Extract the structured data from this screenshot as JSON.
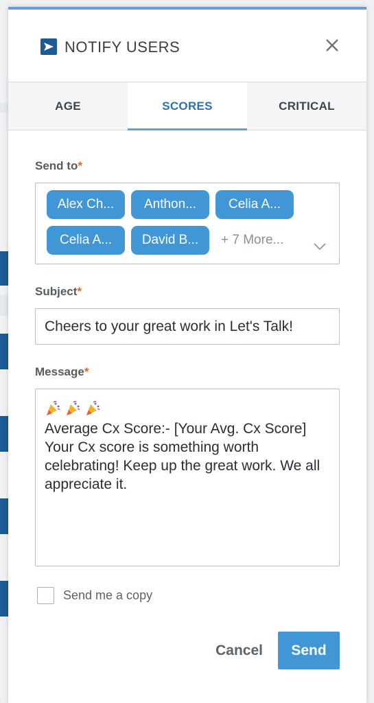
{
  "header": {
    "title": "NOTIFY USERS"
  },
  "tabs": [
    {
      "label": "AGE",
      "active": false
    },
    {
      "label": "SCORES",
      "active": true
    },
    {
      "label": "CRITICAL",
      "active": false
    }
  ],
  "send_to": {
    "label": "Send to",
    "required_mark": "*",
    "chips": [
      "Alex Ch...",
      "Anthon...",
      "Celia A...",
      "Celia A...",
      "David B..."
    ],
    "more_label": "+ 7 More..."
  },
  "subject": {
    "label": "Subject",
    "required_mark": "*",
    "value": "Cheers to your great work in Let's Talk!"
  },
  "message": {
    "label": "Message",
    "required_mark": "*",
    "emojis": [
      "party-popper-icon",
      "party-popper-icon",
      "party-popper-icon"
    ],
    "lines": [
      "Average Cx Score:- [Your Avg. Cx Score]",
      "Your Cx score is something worth celebrating! Keep up the great work. We all appreciate it."
    ]
  },
  "copy": {
    "label": "Send me a copy",
    "checked": false
  },
  "actions": {
    "cancel_label": "Cancel",
    "send_label": "Send"
  },
  "colors": {
    "accent": "#4197d6",
    "brand": "#1f5a92",
    "required": "#e8642c",
    "active_tab": "#2e6fae"
  }
}
